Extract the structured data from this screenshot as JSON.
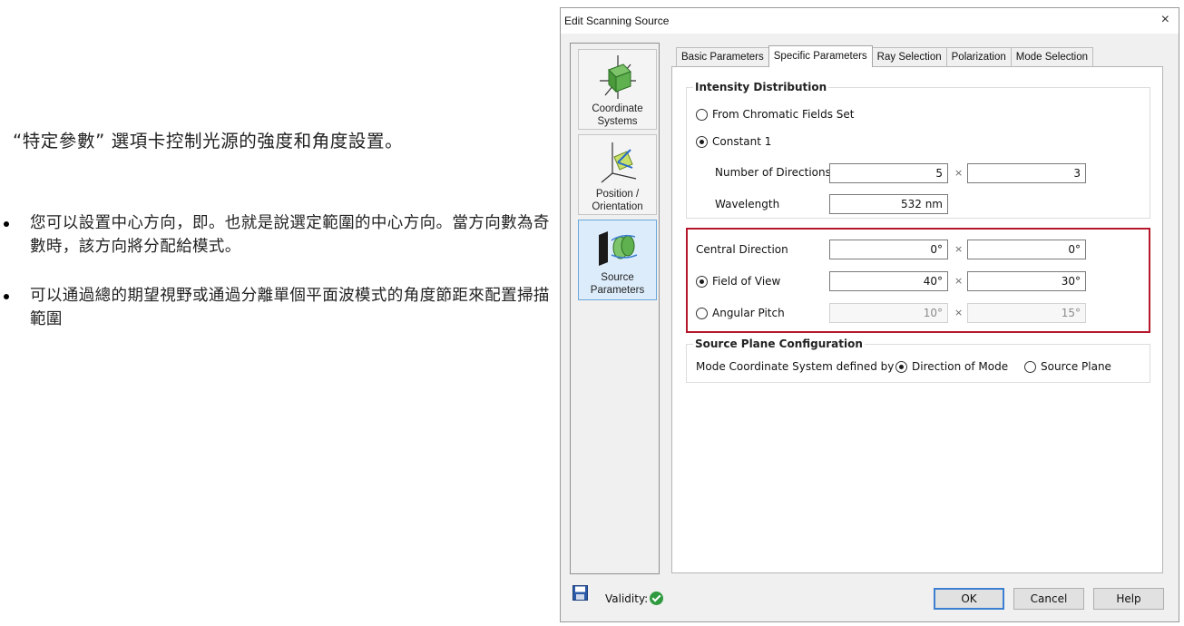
{
  "annotation": {
    "intro": "“特定參數” 選項卡控制光源的強度和角度設置。",
    "bullets": [
      "您可以設置中心方向，即。也就是說選定範圍的中心方向。當方向數為奇數時，該方向將分配給模式。",
      "可以通過總的期望視野或通過分離單個平面波模式的角度節距來配置掃描範圍"
    ]
  },
  "dialog": {
    "title": "Edit Scanning Source",
    "close_glyph": "×",
    "sidebar": [
      {
        "label_line1": "Coordinate",
        "label_line2": "Systems",
        "icon": "coordinate-systems-icon",
        "active": false
      },
      {
        "label_line1": "Position /",
        "label_line2": "Orientation",
        "icon": "position-orientation-icon",
        "active": false
      },
      {
        "label_line1": "Source",
        "label_line2": "Parameters",
        "icon": "source-parameters-icon",
        "active": true
      }
    ],
    "tabs": [
      "Basic Parameters",
      "Specific Parameters",
      "Ray Selection",
      "Polarization",
      "Mode Selection"
    ],
    "active_tab": "Specific Parameters",
    "intensity": {
      "title": "Intensity Distribution",
      "option_chromatic": "From Chromatic Fields Set",
      "option_constant": "Constant 1",
      "selected": "Constant 1",
      "num_directions_label": "Number of Directions",
      "num_directions_x": "5",
      "num_directions_y": "3",
      "wavelength_label": "Wavelength",
      "wavelength_value": "532 nm"
    },
    "angles": {
      "central_label": "Central Direction",
      "central_x": "0°",
      "central_y": "0°",
      "fov_label": "Field of View",
      "fov_x": "40°",
      "fov_y": "30°",
      "pitch_label": "Angular Pitch",
      "pitch_x": "10°",
      "pitch_y": "15°",
      "selected": "Field of View"
    },
    "times_glyph": "×",
    "plane_config": {
      "title": "Source Plane Configuration",
      "label": "Mode Coordinate System defined by",
      "option_mode": "Direction of Mode",
      "option_plane": "Source Plane",
      "selected": "Direction of Mode"
    },
    "footer": {
      "validity_label": "Validity:",
      "ok": "OK",
      "cancel": "Cancel",
      "help": "Help"
    },
    "colors": {
      "highlight": "#b5182b",
      "active_sidebar": "#dcecfa",
      "default_button_border": "#3c7fd1",
      "validity_ok": "#2f9a3f"
    }
  }
}
